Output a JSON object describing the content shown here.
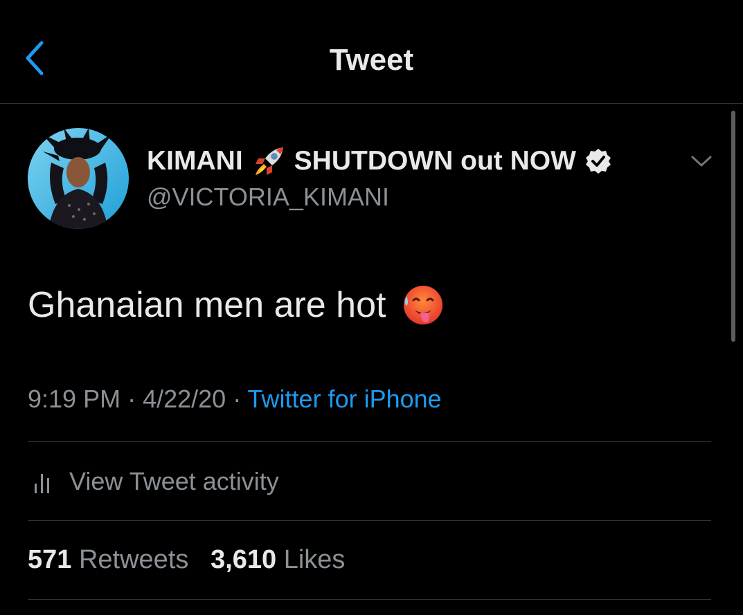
{
  "header": {
    "title": "Tweet",
    "back_icon": "chevron-left-icon"
  },
  "tweet": {
    "author": {
      "display_name_part1": "KIMANI",
      "display_name_part2": "SHUTDOWN out NOW",
      "handle": "@VICTORIA_KIMANI",
      "verified": true,
      "emoji": "rocket-icon"
    },
    "text": "Ghanaian men are hot",
    "text_emoji": "hot-face-icon",
    "time": "9:19 PM",
    "separator": " · ",
    "date": "4/22/20",
    "source": "Twitter for iPhone",
    "activity_label": "View Tweet activity",
    "retweets_count": "571",
    "retweets_label": "Retweets",
    "likes_count": "3,610",
    "likes_label": "Likes"
  },
  "colors": {
    "background": "#000000",
    "accent": "#1d9bf0",
    "text_primary": "#e7e9ea",
    "text_secondary": "#8b9196",
    "divider": "#2f3336"
  }
}
